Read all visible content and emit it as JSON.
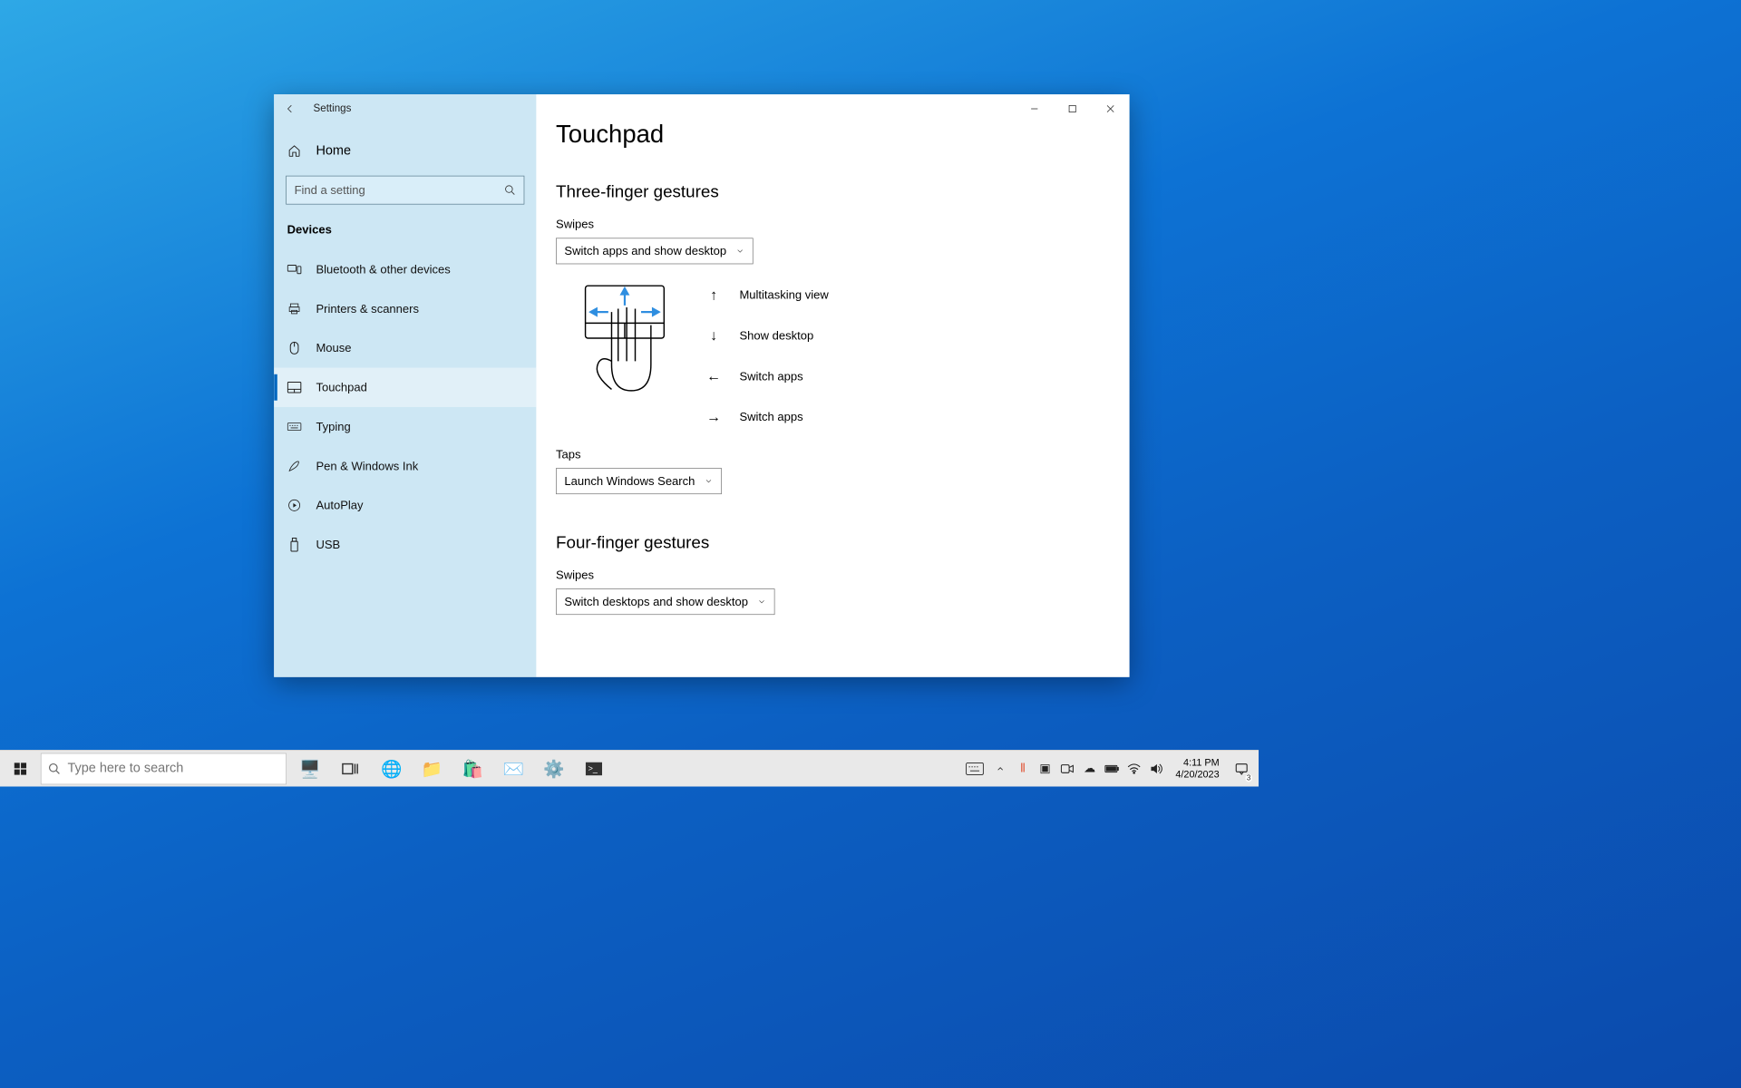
{
  "window": {
    "app_title": "Settings",
    "sidebar": {
      "home": "Home",
      "search_placeholder": "Find a setting",
      "section": "Devices",
      "items": [
        {
          "label": "Bluetooth & other devices"
        },
        {
          "label": "Printers & scanners"
        },
        {
          "label": "Mouse"
        },
        {
          "label": "Touchpad"
        },
        {
          "label": "Typing"
        },
        {
          "label": "Pen & Windows Ink"
        },
        {
          "label": "AutoPlay"
        },
        {
          "label": "USB"
        }
      ]
    },
    "content": {
      "page_title": "Touchpad",
      "three": {
        "heading": "Three-finger gestures",
        "swipes_label": "Swipes",
        "swipes_value": "Switch apps and show desktop",
        "legend": {
          "up": "Multitasking view",
          "down": "Show desktop",
          "left": "Switch apps",
          "right": "Switch apps"
        },
        "taps_label": "Taps",
        "taps_value": "Launch Windows Search"
      },
      "four": {
        "heading": "Four-finger gestures",
        "swipes_label": "Swipes",
        "swipes_value": "Switch desktops and show desktop"
      }
    }
  },
  "taskbar": {
    "search_placeholder": "Type here to search",
    "time": "4:11 PM",
    "date": "4/20/2023",
    "notification_count": "3"
  }
}
